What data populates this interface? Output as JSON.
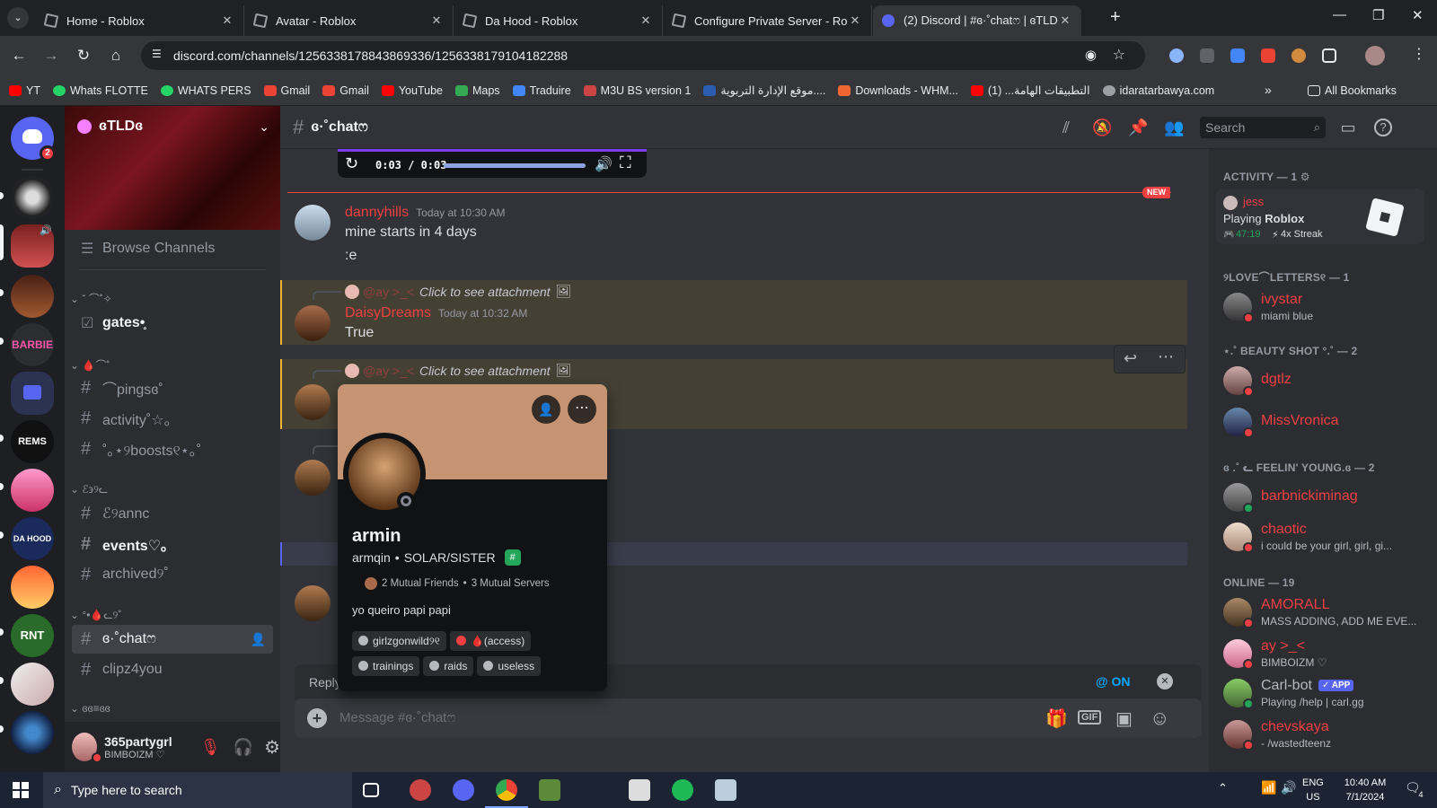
{
  "browser": {
    "tabs": [
      {
        "title": "Home - Roblox"
      },
      {
        "title": "Avatar - Roblox"
      },
      {
        "title": "Da Hood - Roblox"
      },
      {
        "title": "Configure Private Server - Roblo"
      },
      {
        "title": "(2) Discord | #ɞ·˚chatෆ | ɞTLDɞ"
      }
    ],
    "url": "discord.com/channels/1256338178843869336/1256338179104182288",
    "bookmarks": [
      "YT",
      "Whats FLOTTE",
      "WHATS  PERS",
      "Gmail",
      "Gmail",
      "YouTube",
      "Maps",
      "Traduire",
      "M3U BS version 1",
      "موقع الإدارة التربوية....",
      "Downloads - WHM...",
      "التطبيقات الهامة... (1)",
      "idaratarbawya.com"
    ],
    "all_bookmarks": "All Bookmarks"
  },
  "servers": {
    "badge": "2"
  },
  "server": {
    "name": "ɞTLDɞ",
    "browse": "Browse Channels",
    "categories": [
      {
        "label": "ˇ ⌒˚✧"
      },
      {
        "label": "🩸⌒˚"
      },
      {
        "label": "ℰ϶୨ᓚ"
      },
      {
        "label": "°•🩸ᓚ୨˚"
      },
      {
        "label": "ɞɞ≡ɞɞ"
      }
    ],
    "channels": [
      {
        "name": "gates•̥"
      },
      {
        "name": "⌒pingsɞ˚"
      },
      {
        "name": "activity˚☆。"
      },
      {
        "name": "˚｡⋆୨boosts୧⋆｡˚"
      },
      {
        "name": "ℰ୨annc"
      },
      {
        "name": "events♡｡"
      },
      {
        "name": "archived୨˚"
      },
      {
        "name": "ɞ·˚chatෆ"
      },
      {
        "name": "clipz4you"
      }
    ]
  },
  "user": {
    "name": "365partygrl",
    "status": "BIMBOIZM ♡"
  },
  "channel": {
    "title": "ɞ·˚chatෆ",
    "search_placeholder": "Search"
  },
  "video": {
    "time": "0:03 / 0:03",
    "progress": 1.0
  },
  "new_label": "NEW",
  "messages": [
    {
      "author": "dannyhills",
      "time": "Today at 10:30 AM",
      "lines": [
        "mine starts in 4 days",
        ":e"
      ]
    },
    {
      "reply_to": "@ay >_<",
      "reply_text": "Click to see attachment",
      "author": "DaisyDreams",
      "time": "Today at 10:32 AM",
      "lines": [
        "True"
      ]
    },
    {
      "reply_to": "@ay >_<",
      "reply_text": "Click to see attachment"
    }
  ],
  "reply_bar": {
    "label": "Reply",
    "mention": "@ ON"
  },
  "message_input": {
    "placeholder": "Message #ɞ·˚chatෆ"
  },
  "profile": {
    "display_name": "armin",
    "username": "armqin",
    "pronouns": "SOLAR/SISTER",
    "mutuals": "2 Mutual Friends",
    "servers": "3 Mutual Servers",
    "bio": "yo queiro papi papi",
    "roles": [
      "girlzgonwild୨୧",
      "🩸(access)",
      "trainings",
      "raids",
      "useless"
    ]
  },
  "members": {
    "activity_header": "ACTIVITY — 1",
    "activity": {
      "name": "jess",
      "playing_prefix": "Playing ",
      "game": "Roblox",
      "time": "47:19",
      "streak": "4x Streak"
    },
    "groups": [
      {
        "header": "୨LOVE⌒LETTERS୧ — 1",
        "members": [
          {
            "name": "ivystar",
            "status": "miami blue"
          }
        ]
      },
      {
        "header": "⋆.˚ BEAUTY SHOT °.˚ — 2",
        "members": [
          {
            "name": "dgtlz",
            "status": ""
          },
          {
            "name": "MissVronica",
            "status": ""
          }
        ]
      },
      {
        "header": "ɞ .˚ ᓚ FEELIN' YOUNG.ɞ — 2",
        "members": [
          {
            "name": "barbnickiminag",
            "status": ""
          },
          {
            "name": "chaotic",
            "status": "i could be your girl, girl, gi..."
          }
        ]
      },
      {
        "header": "ONLINE — 19",
        "members": [
          {
            "name": "AMORALL",
            "status": "MASS ADDING, ADD ME EVE..."
          },
          {
            "name": "ay >_<",
            "status": "BIMBOIZM ♡"
          },
          {
            "name": "Carl-bot",
            "status": "Playing /help | carl.gg",
            "badge": "✓ APP"
          },
          {
            "name": "chevskaya",
            "status": "- /wastedteenz"
          }
        ]
      }
    ]
  },
  "taskbar": {
    "search": "Type here to search",
    "lang1": "ENG",
    "lang2": "US",
    "time": "10:40 AM",
    "date": "7/1/2024",
    "notif": "4"
  }
}
